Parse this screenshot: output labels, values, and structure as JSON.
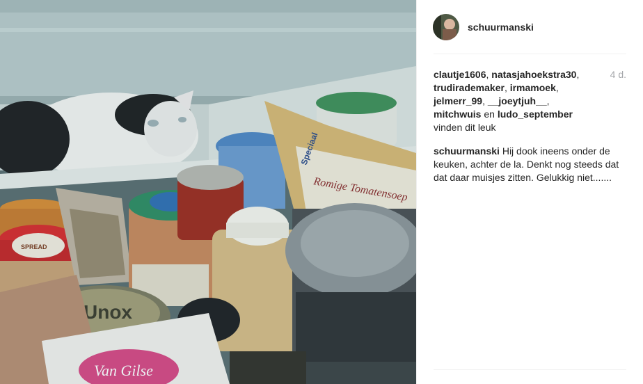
{
  "post": {
    "username": "schuurmanski",
    "time_ago": "4 d.",
    "likers": [
      "clautje1606",
      "natasjahoekstra30",
      "trudirademaker",
      "irmamoek",
      "jelmerr_99",
      "__joeytjuh__",
      "mitchwuis"
    ],
    "likers_last": "ludo_september",
    "and_word": "en",
    "likes_suffix": "vinden dit leuk",
    "caption_text": "Hij dook ineens onder de keuken, achter de la. Denkt nog steeds dat dat daar muisjes zitten. Gelukkig niet......."
  },
  "photo": {
    "soup_label": "Romige Tomatensoep",
    "soup_brand": "Speciaal",
    "lid_text": "Unox",
    "wafer_brand": "Van Gilse",
    "jar_label_left": "SPREAD"
  }
}
